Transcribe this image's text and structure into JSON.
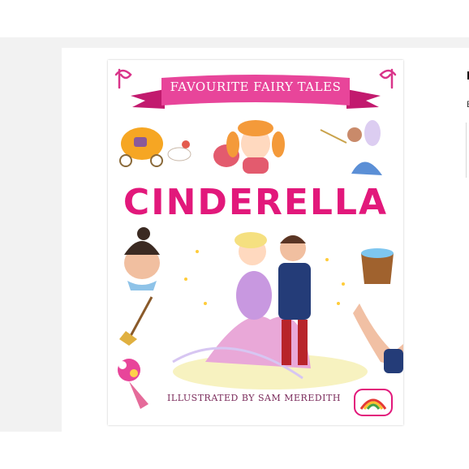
{
  "product": {
    "cover": {
      "series_label": "FAVOURITE FAIRY TALES",
      "title": "CINDERELLA",
      "credit": "ILLUSTRATED BY SAM MEREDITH"
    },
    "side_panel": {
      "title_fragment": "I",
      "subtitle_fragment": "E"
    }
  },
  "colors": {
    "accent_pink": "#e2187b",
    "banner_pink": "#e8459a",
    "page_bg": "#f2f2f2"
  },
  "icons": [
    "pumpkin-carriage-icon",
    "girl-face-icon",
    "fairy-godmother-icon",
    "stepsister-face-icon",
    "water-bucket-icon",
    "broom-icon",
    "flower-bouquet-icon",
    "glass-slipper-hand-icon",
    "rainbow-publisher-logo",
    "curl-ornament-icon"
  ]
}
